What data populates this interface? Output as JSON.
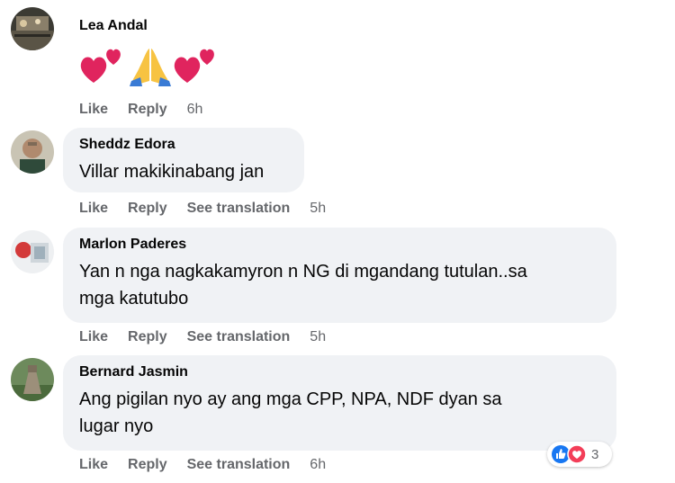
{
  "comments": [
    {
      "author": "Lea Andal",
      "actions": {
        "like": "Like",
        "reply": "Reply",
        "time": "6h"
      }
    },
    {
      "author": "Sheddz Edora",
      "text": "Villar makikinabang jan",
      "actions": {
        "like": "Like",
        "reply": "Reply",
        "translate": "See translation",
        "time": "5h"
      }
    },
    {
      "author": "Marlon Paderes",
      "text_lines": [
        "Yan n nga nagkakamyron n NG di mgandang tutulan..sa",
        "mga katutubo"
      ],
      "actions": {
        "like": "Like",
        "reply": "Reply",
        "translate": "See translation",
        "time": "5h"
      }
    },
    {
      "author": "Bernard Jasmin",
      "text_lines": [
        "Ang pigilan nyo ay ang mga CPP, NPA, NDF dyan sa",
        "lugar nyo"
      ],
      "actions": {
        "like": "Like",
        "reply": "Reply",
        "translate": "See translation",
        "time": "6h"
      },
      "reactions": {
        "icons": [
          "like-icon",
          "love-icon"
        ],
        "count": "3"
      }
    }
  ],
  "emojis": [
    "heart-icon",
    "praying-hands-icon",
    "heart-icon"
  ],
  "colors": {
    "bubble": "#f0f2f5",
    "meta": "#65676b",
    "like_blue": "#1877f2",
    "love_red": "#f33e58",
    "heart": "#e0245e"
  }
}
